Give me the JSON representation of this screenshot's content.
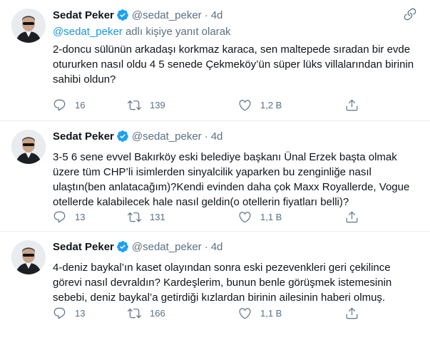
{
  "tweets": [
    {
      "name": "Sedat Peker",
      "handle": "@sedat_peker",
      "dot": "·",
      "time": "4d",
      "reply_to": {
        "mention": "@sedat_peker",
        "suffix": " adlı kişiye yanıt olarak"
      },
      "text": "2-doncu sülünün arkadaşı korkmaz karaca, sen maltepede sıradan bir evde otururken nasıl oldu 4 5 senede Çekmeköy’ün süper lüks villalarından birinin sahibi oldun?",
      "replies": "16",
      "retweets": "139",
      "likes": "1,2 B"
    },
    {
      "name": "Sedat Peker",
      "handle": "@sedat_peker",
      "dot": "·",
      "time": "4d",
      "text": "3-5 6 sene evvel Bakırköy eski belediye başkanı Ünal Erzek başta olmak üzere tüm CHP’li isimlerden sinyalcilik yaparken bu zenginliğe nasıl ulaştın(ben anlatacağım)?Kendi evinden daha çok Maxx Royallerde, Vogue otellerde kalabilecek hale nasıl geldin(o otellerin fiyatları belli)?",
      "replies": "13",
      "retweets": "131",
      "likes": "1,1 B"
    },
    {
      "name": "Sedat Peker",
      "handle": "@sedat_peker",
      "dot": "·",
      "time": "4d",
      "text": "4-deniz baykal’ın kaset olayından sonra eski pezevenkleri geri çekilince görevi nasıl devraldın? Kardeşlerim, bunun benle görüşmek istemesinin sebebi, deniz baykal’a getirdiği kızlardan birinin ailesinin haberi olmuş.",
      "replies": "13",
      "retweets": "166",
      "likes": "1,1 B"
    }
  ],
  "icons": {
    "verified": "verified-badge-icon",
    "more": "more-options-icon",
    "reply": "reply-icon",
    "retweet": "retweet-icon",
    "like": "heart-icon",
    "share": "share-icon"
  },
  "colors": {
    "accent": "#1da1f2",
    "mention": "#1b95e0",
    "secondary_text": "#5b7083",
    "border": "#e6ecf0"
  }
}
